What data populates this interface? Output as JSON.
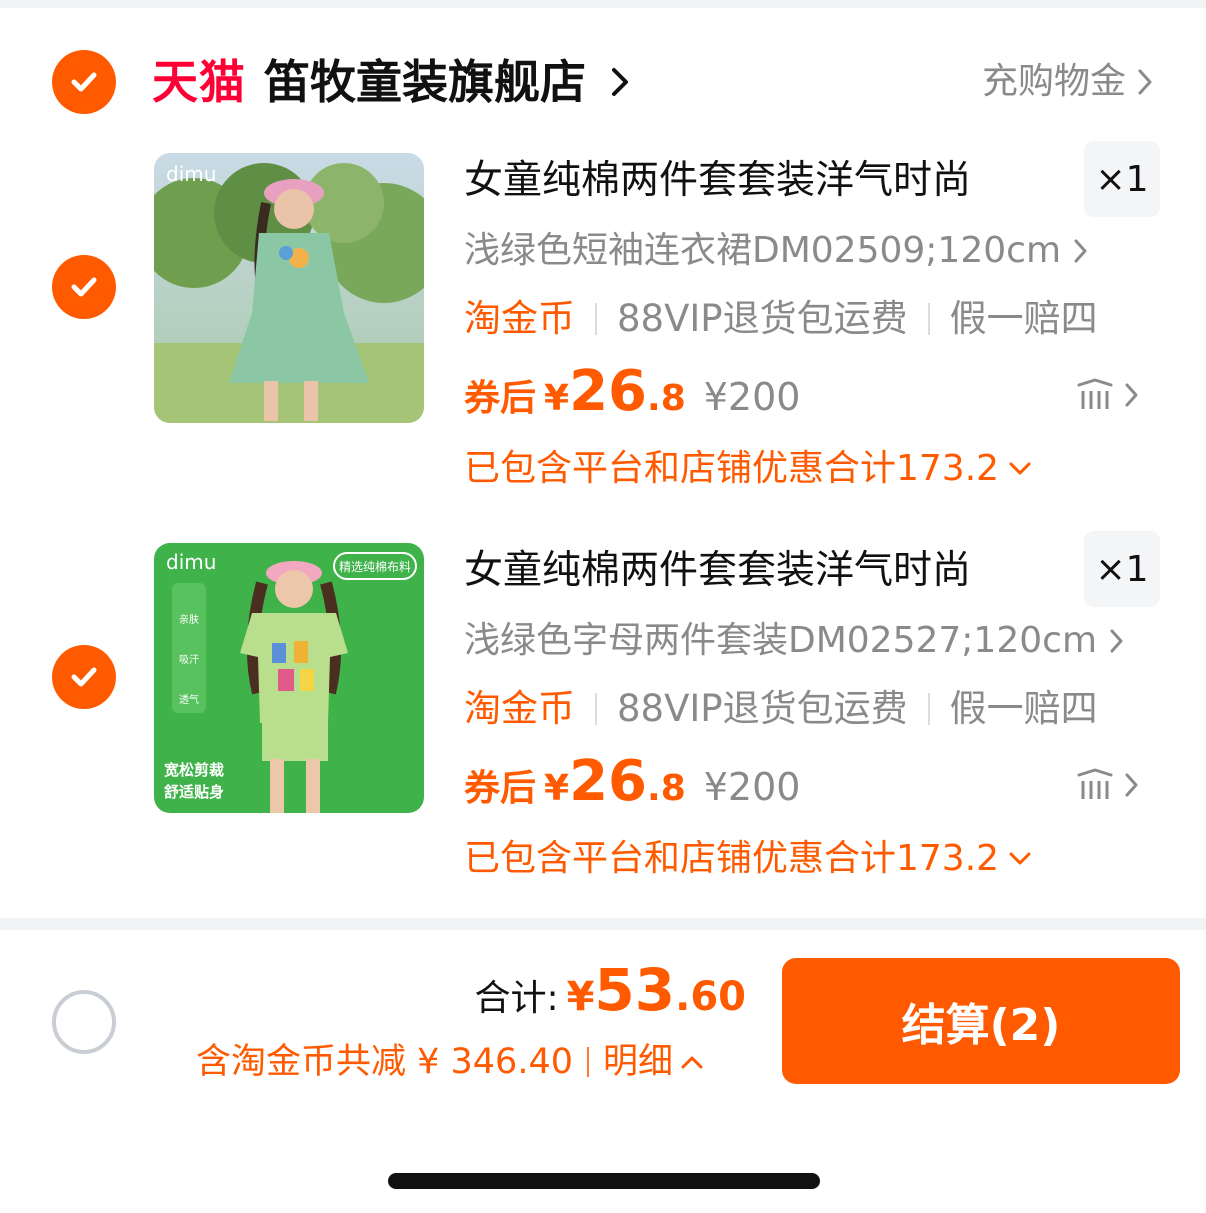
{
  "store": {
    "brand": "天猫",
    "name": "笛牧童装旗舰店",
    "action": "充购物金"
  },
  "items": [
    {
      "title": "女童纯棉两件套套装洋气时尚",
      "quantity": "×1",
      "sku": "浅绿色短袖连衣裙DM02509;120cm",
      "tags": [
        "淘金币",
        "88VIP退货包运费",
        "假一赔四"
      ],
      "coupon_label": "券后",
      "price_yen": "¥",
      "price_int": "26",
      "price_dec": ".8",
      "original_price": "¥200",
      "discount_note": "已包含平台和店铺优惠合计173.2",
      "thumb_brand": "dimu",
      "thumb_icon": "girl-green-dress-photo"
    },
    {
      "title": "女童纯棉两件套套装洋气时尚",
      "quantity": "×1",
      "sku": "浅绿色字母两件套装DM02527;120cm",
      "tags": [
        "淘金币",
        "88VIP退货包运费",
        "假一赔四"
      ],
      "coupon_label": "券后",
      "price_yen": "¥",
      "price_int": "26",
      "price_dec": ".8",
      "original_price": "¥200",
      "discount_note": "已包含平台和店铺优惠合计173.2",
      "thumb_brand": "dimu",
      "thumb_badge": "精选纯棉布料",
      "thumb_features": [
        "亲肤",
        "吸汗",
        "透气"
      ],
      "thumb_caption_1": "宽松剪裁",
      "thumb_caption_2": "舒适贴身",
      "thumb_icon": "girl-letter-tshirt-photo"
    }
  ],
  "footer": {
    "total_label": "合计:",
    "total_yen": "¥",
    "total_int": "53",
    "total_dec": ".60",
    "saving_text": "含淘金币共减 ¥ 346.40",
    "detail_label": "明细",
    "checkout_label": "结算(2)"
  },
  "colors": {
    "accent": "#ff5a00",
    "tmall": "#ff0036",
    "muted": "#8a8a8a"
  }
}
